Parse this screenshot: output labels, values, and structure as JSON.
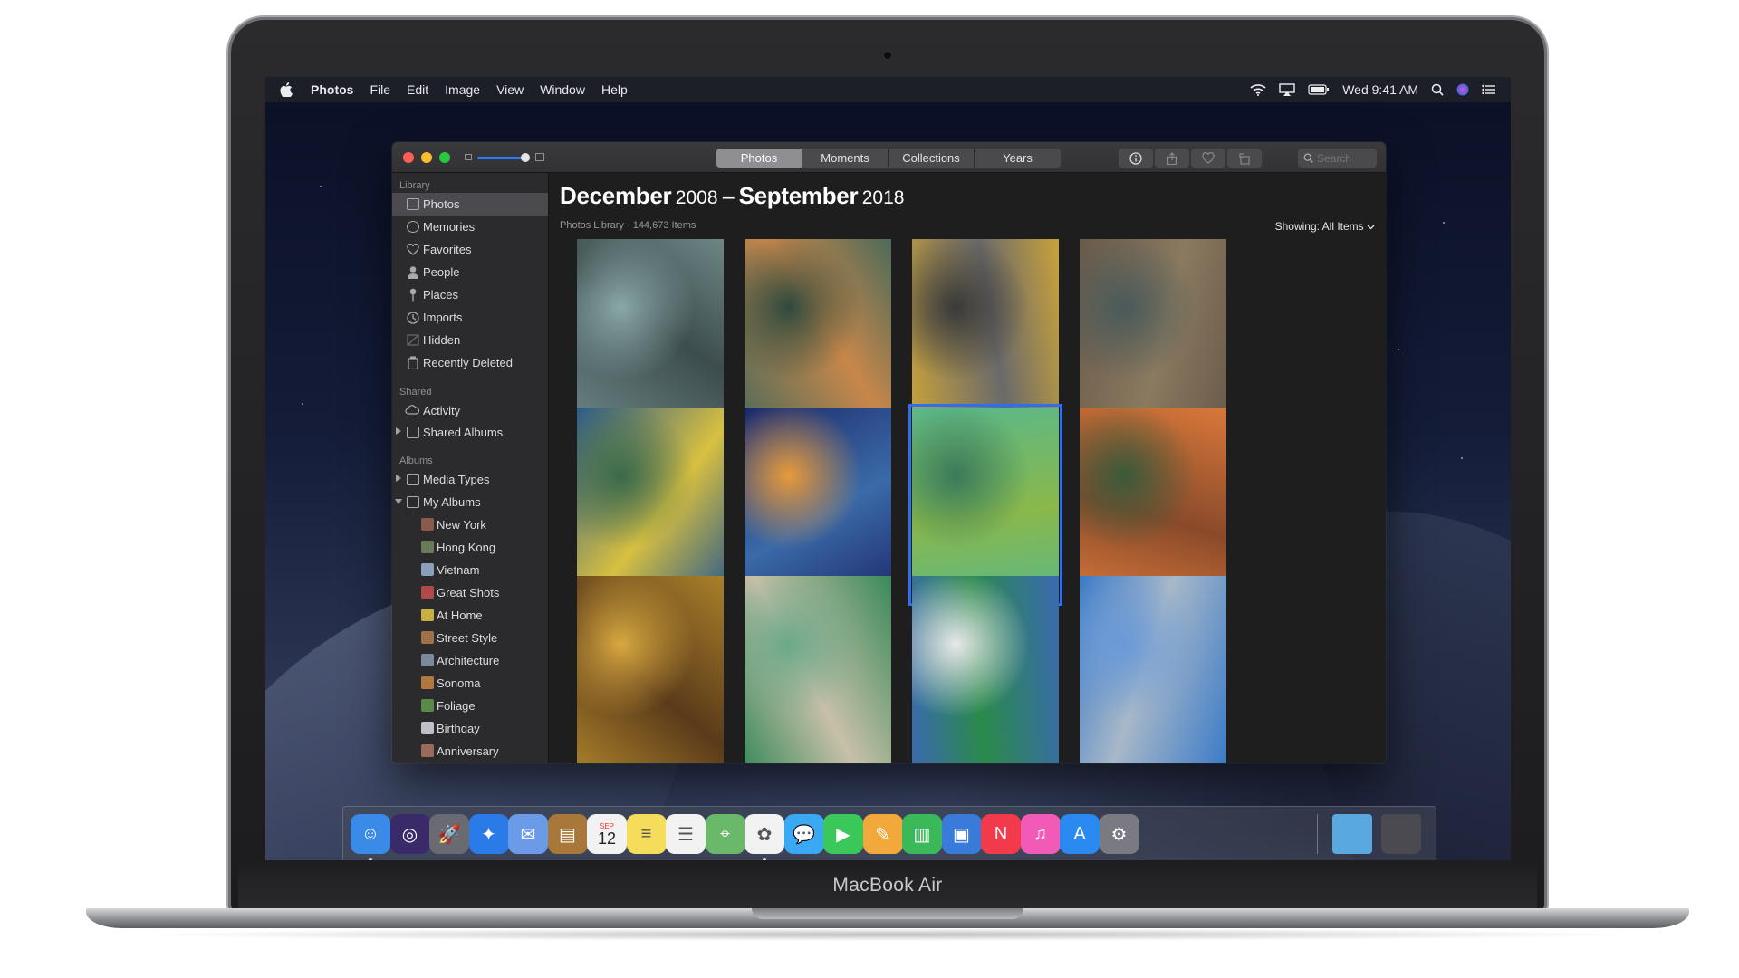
{
  "device": {
    "label": "MacBook Air"
  },
  "menubar": {
    "app_name": "Photos",
    "menus": [
      "File",
      "Edit",
      "Image",
      "View",
      "Window",
      "Help"
    ],
    "clock": "Wed 9:41 AM",
    "status_icons": [
      "wifi-icon",
      "airplay-icon",
      "battery-icon",
      "spotlight-icon",
      "siri-icon",
      "notification-center-icon"
    ]
  },
  "window": {
    "tabs": [
      {
        "label": "Photos",
        "active": true
      },
      {
        "label": "Moments",
        "active": false
      },
      {
        "label": "Collections",
        "active": false
      },
      {
        "label": "Years",
        "active": false
      }
    ],
    "toolbar_buttons": [
      "info-icon",
      "share-icon",
      "heart-icon",
      "rotate-icon"
    ],
    "search": {
      "placeholder": "Search"
    }
  },
  "sidebar": {
    "library_header": "Library",
    "library_items": [
      {
        "label": "Photos",
        "icon": "photos-icon",
        "selected": true
      },
      {
        "label": "Memories",
        "icon": "memories-icon"
      },
      {
        "label": "Favorites",
        "icon": "heart-icon"
      },
      {
        "label": "People",
        "icon": "person-icon"
      },
      {
        "label": "Places",
        "icon": "pin-icon"
      },
      {
        "label": "Imports",
        "icon": "clock-icon"
      },
      {
        "label": "Hidden",
        "icon": "hidden-icon"
      },
      {
        "label": "Recently Deleted",
        "icon": "trash-icon"
      }
    ],
    "shared_header": "Shared",
    "shared_items": [
      {
        "label": "Activity",
        "icon": "cloud-icon"
      },
      {
        "label": "Shared Albums",
        "icon": "folder-icon"
      }
    ],
    "albums_header": "Albums",
    "album_groups": [
      {
        "label": "Media Types",
        "icon": "folder-icon"
      },
      {
        "label": "My Albums",
        "icon": "folder-icon"
      }
    ],
    "my_albums": [
      {
        "label": "New York",
        "color": "#8a5a4a"
      },
      {
        "label": "Hong Kong",
        "color": "#6a7a5a"
      },
      {
        "label": "Vietnam",
        "color": "#8aa0b8"
      },
      {
        "label": "Great Shots",
        "color": "#b04a4a"
      },
      {
        "label": "At Home",
        "color": "#c8b040"
      },
      {
        "label": "Street Style",
        "color": "#a0704a"
      },
      {
        "label": "Architecture",
        "color": "#7a8a9a"
      },
      {
        "label": "Sonoma",
        "color": "#b07840"
      },
      {
        "label": "Foliage",
        "color": "#5a8a4a"
      },
      {
        "label": "Birthday",
        "color": "#c0c0c8"
      },
      {
        "label": "Anniversary",
        "color": "#9a6a5a"
      }
    ]
  },
  "main": {
    "title_month_start": "December",
    "title_year_start": "2008",
    "title_separator": "–",
    "title_month_end": "September",
    "title_year_end": "2018",
    "subtitle": "Photos Library · 144,673 Items",
    "showing": "Showing: All Items"
  },
  "photos": [
    {
      "name": "photo-lamp",
      "colors": [
        "#6d8686",
        "#3d4d4d",
        "#8aa8a8"
      ]
    },
    {
      "name": "photo-stairs-green",
      "colors": [
        "#4c6a5a",
        "#c8874a",
        "#2f4a3e"
      ]
    },
    {
      "name": "photo-shadow-yellow",
      "colors": [
        "#c9a23a",
        "#6a6a6a",
        "#3a3a3a"
      ]
    },
    {
      "name": "photo-aerial-rainbow",
      "colors": [
        "#6a5a4a",
        "#8a7a60",
        "#4a5a5a"
      ]
    },
    {
      "name": "photo-fence-zigzag",
      "colors": [
        "#2a5a8a",
        "#d8c040",
        "#3a6a4a"
      ]
    },
    {
      "name": "photo-paddle-blue",
      "colors": [
        "#1e2a6a",
        "#3a6aa8",
        "#e89a3a"
      ]
    },
    {
      "name": "photo-green-pools",
      "colors": [
        "#5ab88a",
        "#8ab84a",
        "#3a7a5a"
      ],
      "selected": true
    },
    {
      "name": "photo-orange-steps",
      "colors": [
        "#d8783a",
        "#8a4a2a",
        "#3a5a3a"
      ]
    },
    {
      "name": "photo-gold-curtain",
      "colors": [
        "#a8802a",
        "#5a3a1a",
        "#d8a840"
      ]
    },
    {
      "name": "photo-green-edge",
      "colors": [
        "#3a8a5a",
        "#c8c0a8",
        "#6aa88a"
      ]
    },
    {
      "name": "photo-green-building",
      "colors": [
        "#3a6ab0",
        "#2a8a4a",
        "#e8e8e8"
      ]
    },
    {
      "name": "photo-horse-statues",
      "colors": [
        "#3a7ac8",
        "#a8b8c8",
        "#6a9ad8"
      ]
    }
  ],
  "dock": {
    "apps": [
      {
        "name": "finder",
        "color": "#3a8ae8",
        "running": true
      },
      {
        "name": "siri",
        "color": "#3a2a6a",
        "running": false
      },
      {
        "name": "launchpad",
        "color": "#6a6a72",
        "running": false
      },
      {
        "name": "safari",
        "color": "#2a7ae8",
        "running": false
      },
      {
        "name": "mail",
        "color": "#6a9ae8",
        "running": false
      },
      {
        "name": "contacts",
        "color": "#a8783a",
        "running": false
      },
      {
        "name": "calendar",
        "color": "#f2f2f2",
        "running": false
      },
      {
        "name": "notes",
        "color": "#f5dc5a",
        "running": false
      },
      {
        "name": "reminders",
        "color": "#f2f2f2",
        "running": false
      },
      {
        "name": "maps",
        "color": "#6ab86a",
        "running": false
      },
      {
        "name": "photos",
        "color": "#f2f2f2",
        "running": true
      },
      {
        "name": "messages",
        "color": "#3aa8f2",
        "running": false
      },
      {
        "name": "facetime",
        "color": "#3ac85a",
        "running": false
      },
      {
        "name": "pages",
        "color": "#f2a83a",
        "running": false
      },
      {
        "name": "numbers",
        "color": "#3ab85a",
        "running": false
      },
      {
        "name": "keynote",
        "color": "#3a7ad8",
        "running": false
      },
      {
        "name": "news",
        "color": "#f23a4a",
        "running": false
      },
      {
        "name": "itunes",
        "color": "#f25ab8",
        "running": false
      },
      {
        "name": "app-store",
        "color": "#2a8af2",
        "running": false
      },
      {
        "name": "system-preferences",
        "color": "#7a7a82",
        "running": false
      }
    ],
    "calendar_day": "12",
    "calendar_month": "SEP",
    "right": [
      {
        "name": "downloads-folder",
        "color": "#5aa8e0"
      },
      {
        "name": "trash",
        "color": "#4a4a50"
      }
    ]
  }
}
